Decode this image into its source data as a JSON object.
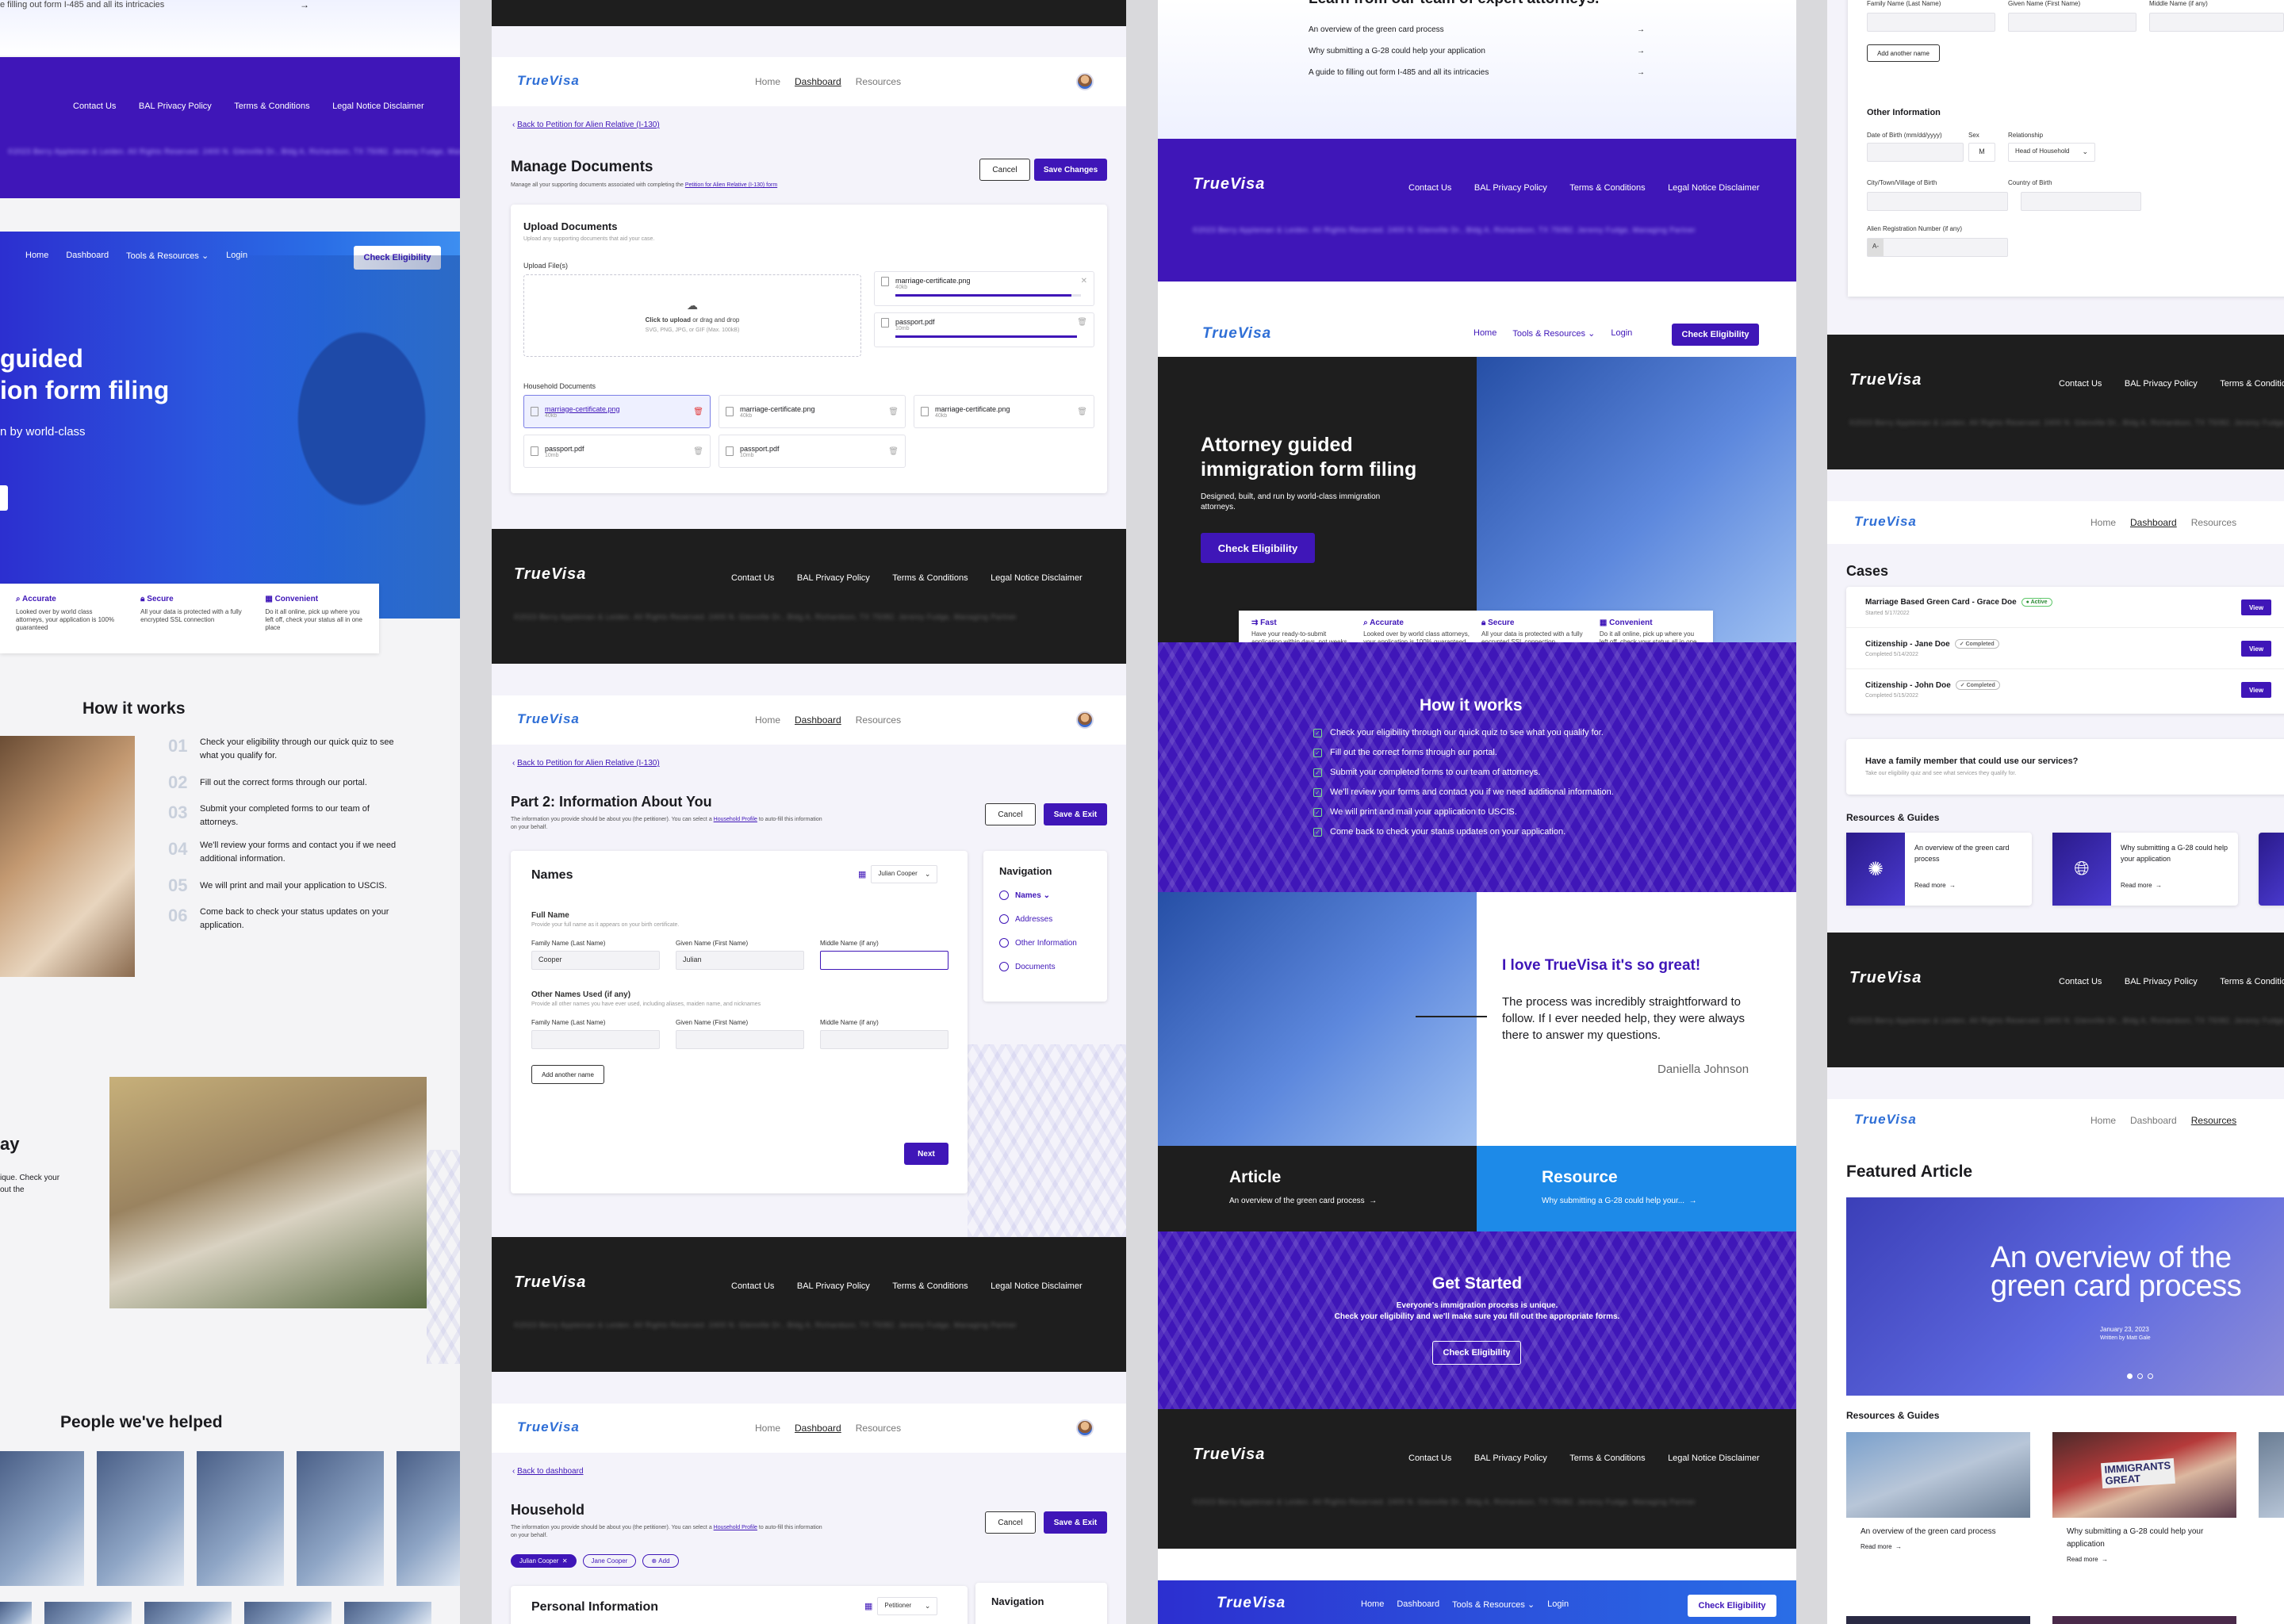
{
  "brand": {
    "name": "TrueVisa"
  },
  "nav": {
    "home": "Home",
    "dashboard": "Dashboard",
    "resources": "Resources",
    "tools": "Tools & Resources",
    "login": "Login",
    "check": "Check Eligibility"
  },
  "footer": {
    "contact": "Contact Us",
    "privacy": "BAL Privacy Policy",
    "terms": "Terms & Conditions",
    "legal": "Legal Notice Disclaimer",
    "copyright": "©2023 Berry Appleman & Leiden. All Rights Reserved. 2400 N. Glenville Dr., Bldg A, Richardson, TX 75082. Jeremy Fudge, Managing Partner"
  },
  "col1": {
    "top_text": "e filling out form I-485 and all its intricacies",
    "hero_l1": "guided",
    "hero_l2": "ion form filing",
    "hero_sub": "n by world-class",
    "features": [
      {
        "t": "Accurate",
        "d": "Looked over by world class attorneys, your application is 100% guaranteed"
      },
      {
        "t": "Secure",
        "d": "All your data is protected with a fully encrypted SSL connection"
      },
      {
        "t": "Convenient",
        "d": "Do it all online, pick up where you left off, check your status all in one place"
      }
    ],
    "how_title": "How it works",
    "steps": [
      {
        "n": "01",
        "t": "Check your eligibility through our quick quiz to see what you qualify for."
      },
      {
        "n": "02",
        "t": "Fill out the correct forms through our portal."
      },
      {
        "n": "03",
        "t": "Submit your completed forms to our team of attorneys."
      },
      {
        "n": "04",
        "t": "We'll review your forms and contact you if we need additional information."
      },
      {
        "n": "05",
        "t": "We will print and mail your application to USCIS."
      },
      {
        "n": "06",
        "t": "Come back to check your status updates on your application."
      }
    ],
    "ay": "ay",
    "ay_text": "ique. Check your\nout the",
    "people_title": "People we've helped"
  },
  "col2": {
    "manage": {
      "back": "Back to Petition for Alien Relative (I-130)",
      "title": "Manage Documents",
      "desc_pre": "Manage all your supporting documents associated with completing the ",
      "desc_link": "Petition for Alien Relative (I-130) form",
      "cancel": "Cancel",
      "save": "Save Changes",
      "upload_title": "Upload Documents",
      "upload_sub": "Upload any supporting documents that aid your case.",
      "upload_files": "Upload File(s)",
      "drop_click": "Click to upload",
      "drop_rest": " or drag and drop",
      "drop_types": "SVG, PNG, JPG, or GIF (Max. 100kB)",
      "uploads": [
        {
          "name": "marriage-certificate.png",
          "size": "40kb",
          "progress": 0.95
        },
        {
          "name": "passport.pdf",
          "size": "10mb",
          "progress": 1.0
        }
      ],
      "household_docs": "Household Documents",
      "docs": [
        {
          "name": "marriage-certificate.png",
          "size": "40kb"
        },
        {
          "name": "marriage-certificate.png",
          "size": "40kb"
        },
        {
          "name": "marriage-certificate.png",
          "size": "40kb"
        },
        {
          "name": "passport.pdf",
          "size": "10mb"
        },
        {
          "name": "passport.pdf",
          "size": "10mb"
        }
      ]
    },
    "part2": {
      "back": "Back to Petition for Alien Relative (I-130)",
      "title": "Part 2: Information About You",
      "desc_pre": "The information you provide should be about you (the petitioner). You can select a ",
      "desc_link": "Household Profile",
      "desc_post": " to auto-fill this information on your behalf.",
      "cancel": "Cancel",
      "save": "Save & Exit",
      "names_title": "Names",
      "person": "Julian Cooper",
      "full_name": "Full Name",
      "full_hint": "Provide your full name as it appears on your birth certificate.",
      "family": "Family Name (Last Name)",
      "given": "Given Name (First Name)",
      "middle": "Middle Name (if any)",
      "family_val": "Cooper",
      "given_val": "Julian",
      "other_names": "Other Names Used (if any)",
      "other_hint": "Provide all other names you have ever used, including aliases, maiden name, and nicknames",
      "add_name": "Add another name",
      "next": "Next",
      "nav_title": "Navigation",
      "nav_items": [
        "Names",
        "Addresses",
        "Other Information",
        "Documents"
      ]
    },
    "household": {
      "back": "Back to dashboard",
      "title": "Household",
      "desc_pre": "The information you provide should be about you (the petitioner). You can select a ",
      "desc_link": "Household Profile",
      "desc_post": " to auto-fill this information on your behalf.",
      "cancel": "Cancel",
      "save": "Save & Exit",
      "chips": [
        "Julian Cooper",
        "Jane Cooper",
        "Add"
      ],
      "personal": "Personal Information",
      "role": "Petitioner",
      "nav_title": "Navigation"
    }
  },
  "col3": {
    "top_title": "Learn from our team of expert attorneys.",
    "top_links": [
      "An overview of the green card process",
      "Why submitting a G-28 could help your application",
      "A guide to filling out form I-485 and all its intricacies"
    ],
    "hero_title": "Attorney guided immigration form filing",
    "hero_sub": "Designed, built, and run by world-class immigration attorneys.",
    "features": [
      {
        "t": "Fast",
        "d": "Have your ready-to-submit application within days, not weeks"
      },
      {
        "t": "Accurate",
        "d": "Looked over by world class attorneys, your application is 100% guaranteed"
      },
      {
        "t": "Secure",
        "d": "All your data is protected with a fully encrypted SSL connection"
      },
      {
        "t": "Convenient",
        "d": "Do it all online, pick up where you left off, check your status all in one place"
      }
    ],
    "how_title": "How it works",
    "steps": [
      "Check your eligibility through our quick quiz to see what you qualify for.",
      "Fill out the correct forms through our portal.",
      "Submit your completed forms to our team of attorneys.",
      "We'll review your forms and contact you if we need additional information.",
      "We will print and mail your application to USCIS.",
      "Come back to check your status updates on your application."
    ],
    "quote_title": "I love TrueVisa it's so great!",
    "quote": "The process was incredibly straightforward to follow. If I ever needed help, they were always there to answer my questions.",
    "quote_author": "Daniella Johnson",
    "article_label": "Article",
    "article_text": "An overview of the green card process",
    "resource_label": "Resource",
    "resource_text": "Why submitting a G-28 could help your...",
    "gs_title": "Get Started",
    "gs_l1": "Everyone's immigration process is unique.",
    "gs_l2": "Check your eligibility and we'll make sure you fill out the appropriate forms."
  },
  "col4": {
    "family": "Family Name (Last Name)",
    "given": "Given Name (First Name)",
    "middle": "Middle Name (if any)",
    "add_name": "Add another name",
    "other_info": "Other Information",
    "dob": "Date of Birth (mm/dd/yyyy)",
    "sex": "Sex",
    "sex_val": "M",
    "relationship": "Relationship",
    "relationship_val": "Head of Household",
    "city": "City/Town/Village of Birth",
    "country": "Country of Birth",
    "alien": "Alien Registration Number (if any)",
    "alien_prefix": "A-",
    "cases_title": "Cases",
    "cases": [
      {
        "title": "Marriage Based Green Card - Grace Doe",
        "badge": "Active",
        "date": "Started 5/17/2022"
      },
      {
        "title": "Citizenship - Jane Doe",
        "badge": "Completed",
        "date": "Completed 5/14/2022"
      },
      {
        "title": "Citizenship - John Doe",
        "badge": "Completed",
        "date": "Completed 5/15/2022"
      }
    ],
    "view": "View",
    "family_q": "Have a family member that could use our services?",
    "family_sub": "Take our eligibility quiz and see what services they qualify for.",
    "rg_title": "Resources & Guides",
    "rg": [
      {
        "t": "An overview of the green card process",
        "r": "Read more"
      },
      {
        "t": "Why submitting a G-28 could help your application",
        "r": "Read more"
      }
    ],
    "featured_title": "Featured Article",
    "featured_headline": "An overview of the green card process",
    "featured_date": "January 23, 2023",
    "featured_by": "Written by Matt Gale",
    "rg2_title": "Resources & Guides",
    "rg2": [
      {
        "t": "An overview of the green card process",
        "r": "Read more"
      },
      {
        "t": "Why submitting a G-28 could help your application",
        "r": "Read more"
      }
    ],
    "sign1": "IMMIGRANTS",
    "sign2": "GREAT"
  },
  "colors": {
    "purple": "#3f16b8",
    "blue": "#2f6fd6",
    "dark": "#1e1e1e",
    "sky": "#1d8ae8"
  },
  "icons": [
    "arrow-right-icon",
    "search-icon",
    "lock-icon",
    "calendar-icon",
    "check-icon",
    "trash-icon",
    "file-icon",
    "upload-icon",
    "chevron-down-icon",
    "close-icon",
    "chevron-left-icon"
  ]
}
